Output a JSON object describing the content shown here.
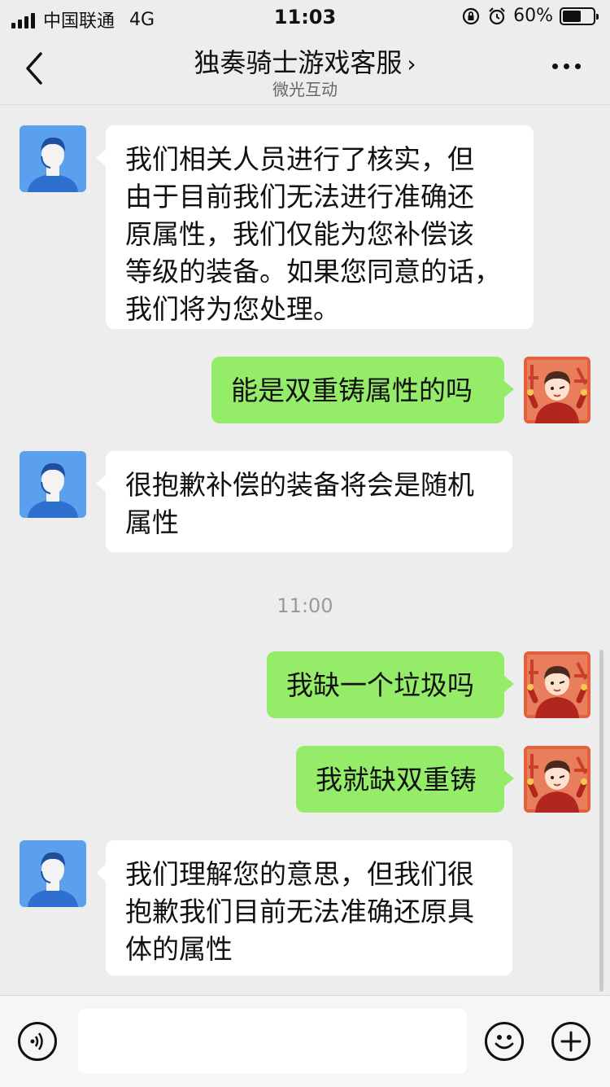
{
  "status": {
    "carrier": "中国联通",
    "network": "4G",
    "time": "11:03",
    "battery": "60%",
    "battery_level": 0.6
  },
  "nav": {
    "title": "独奏骑士游戏客服",
    "title_chevron": "›",
    "subtitle": "微光互动"
  },
  "messages": [
    {
      "side": "left",
      "text": "我们相关人员进行了核实，但\n由于目前我们无法进行准确还\n原属性，我们仅能为您补偿该\n等级的装备。如果您同意的话，\n我们将为您处理。"
    },
    {
      "side": "right",
      "text": "能是双重铸属性的吗"
    },
    {
      "side": "left",
      "text": "很抱歉补偿的装备将会是随机\n属性"
    },
    {
      "side": "right",
      "text": "我缺一个垃圾吗"
    },
    {
      "side": "right",
      "text": "我就缺双重铸"
    },
    {
      "side": "left",
      "text": "我们理解您的意思，但我们很\n抱歉我们目前无法准确还原具\n体的属性"
    }
  ],
  "timestamp": "11:00",
  "colors": {
    "background": "#ededed",
    "bubble_self": "#95ec69",
    "bubble_other": "#ffffff",
    "agent_avatar": "#5aa0ec",
    "user_avatar": "#e3603f"
  },
  "icons": {
    "voice": "voice-icon",
    "emoji": "emoji-icon",
    "plus": "plus-icon",
    "back": "back-chevron-icon",
    "more": "more-dots-icon"
  }
}
